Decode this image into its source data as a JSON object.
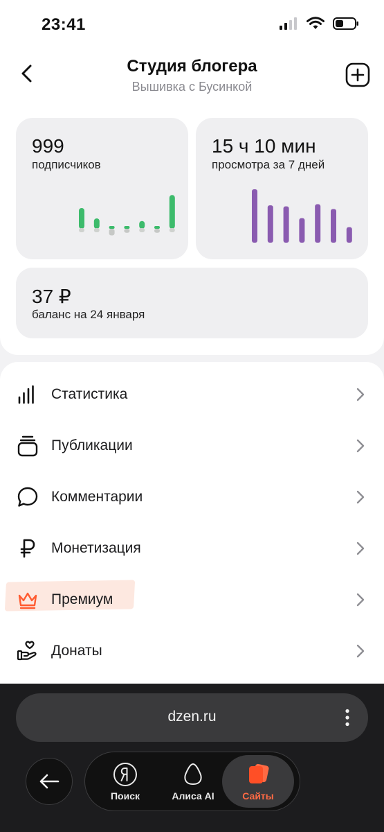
{
  "status_bar": {
    "time": "23:41"
  },
  "header": {
    "title": "Студия блогера",
    "subtitle": "Вышивка с Бусинкой"
  },
  "stats": {
    "subscribers": {
      "value": "999",
      "label": "подписчиков",
      "bars": [
        {
          "value": 4,
          "dir": "up"
        },
        {
          "value": 2,
          "dir": "up"
        },
        {
          "value": -1,
          "dir": "down"
        },
        {
          "value": -0.5,
          "dir": "down"
        },
        {
          "value": 1.5,
          "dir": "up"
        },
        {
          "value": -0.5,
          "dir": "down"
        },
        {
          "value": 6.5,
          "dir": "up"
        }
      ],
      "color": "#3dbb6c"
    },
    "views": {
      "value": "15 ч 10 мин",
      "label": "просмотра за 7 дней",
      "bars": [
        10,
        7,
        6.8,
        4.6,
        7.2,
        6.3,
        2.9
      ],
      "color": "#8a5bb0"
    },
    "balance": {
      "value": "37 ₽",
      "label": "баланс на 24 января"
    }
  },
  "menu": {
    "items": [
      {
        "label": "Статистика",
        "icon": "bar-chart-icon"
      },
      {
        "label": "Публикации",
        "icon": "publications-icon"
      },
      {
        "label": "Комментарии",
        "icon": "comment-icon"
      },
      {
        "label": "Монетизация",
        "icon": "ruble-icon"
      },
      {
        "label": "Премиум",
        "icon": "crown-icon",
        "highlight": true
      },
      {
        "label": "Донаты",
        "icon": "donate-hand-icon"
      }
    ]
  },
  "browser": {
    "url": "dzen.ru",
    "tabs": [
      {
        "label": "Поиск",
        "icon": "yandex-icon"
      },
      {
        "label": "Алиса AI",
        "icon": "alisa-icon"
      },
      {
        "label": "Сайты",
        "icon": "sites-icon",
        "active": true
      }
    ]
  },
  "colors": {
    "accent": "#ff5b30",
    "premium_bg": "#fde8e0"
  }
}
